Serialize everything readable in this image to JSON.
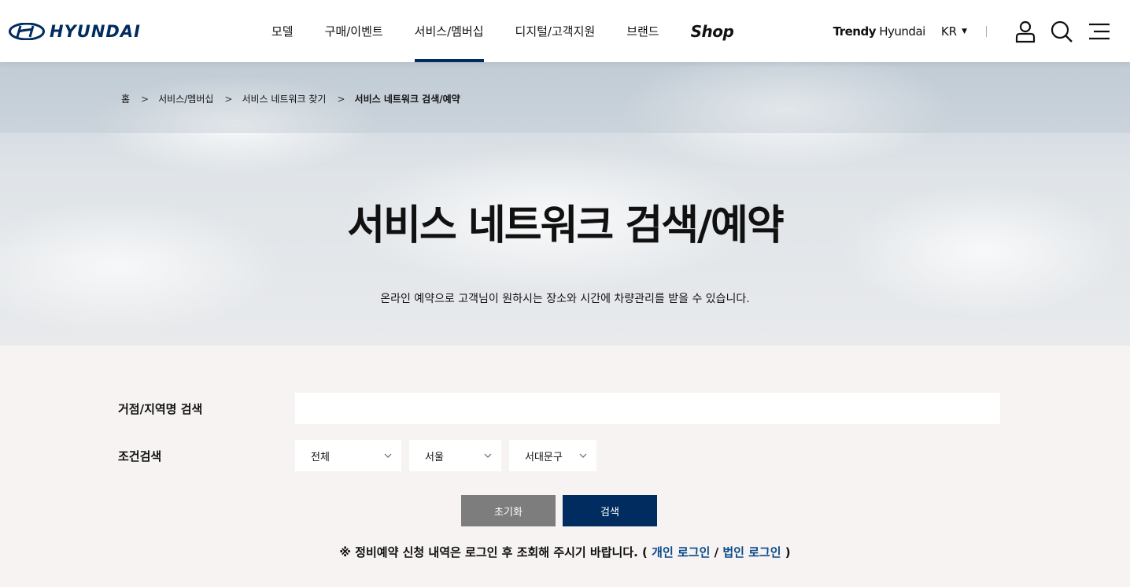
{
  "header": {
    "logo_text": "HYUNDAI",
    "nav": [
      {
        "label": "모델",
        "active": false
      },
      {
        "label": "구매/이벤트",
        "active": false
      },
      {
        "label": "서비스/멤버십",
        "active": true
      },
      {
        "label": "디지털/고객지원",
        "active": false
      },
      {
        "label": "브랜드",
        "active": false
      },
      {
        "label": "Shop",
        "active": false
      }
    ],
    "trendy_bold": "Trendy",
    "trendy_rest": " Hyundai",
    "lang": "KR",
    "icons": [
      "user-icon",
      "search-icon",
      "menu-icon"
    ],
    "accent_color": "#002c5f"
  },
  "breadcrumb": [
    "홈",
    "서비스/멤버십",
    "서비스 네트워크 찾기",
    "서비스 네트워크 검색/예약"
  ],
  "hero": {
    "title": "서비스 네트워크 검색/예약",
    "subtitle": "온라인 예약으로 고객님이 원하시는 장소와 시간에 차량관리를 받을 수 있습니다."
  },
  "form": {
    "search_label": "거점/지역명 검색",
    "search_value": "",
    "condition_label": "조건검색",
    "selects": [
      "전체",
      "서울",
      "서대문구"
    ],
    "reset_label": "초기화",
    "search_button": "검색"
  },
  "notice": {
    "prefix": "※ 정비예약 신청 내역은 로그인 후 조회해 주시기 바랍니다. ( ",
    "personal_login": "개인 로그인",
    "divider": " / ",
    "corporate_login": "법인 로그인",
    "suffix": " )"
  }
}
